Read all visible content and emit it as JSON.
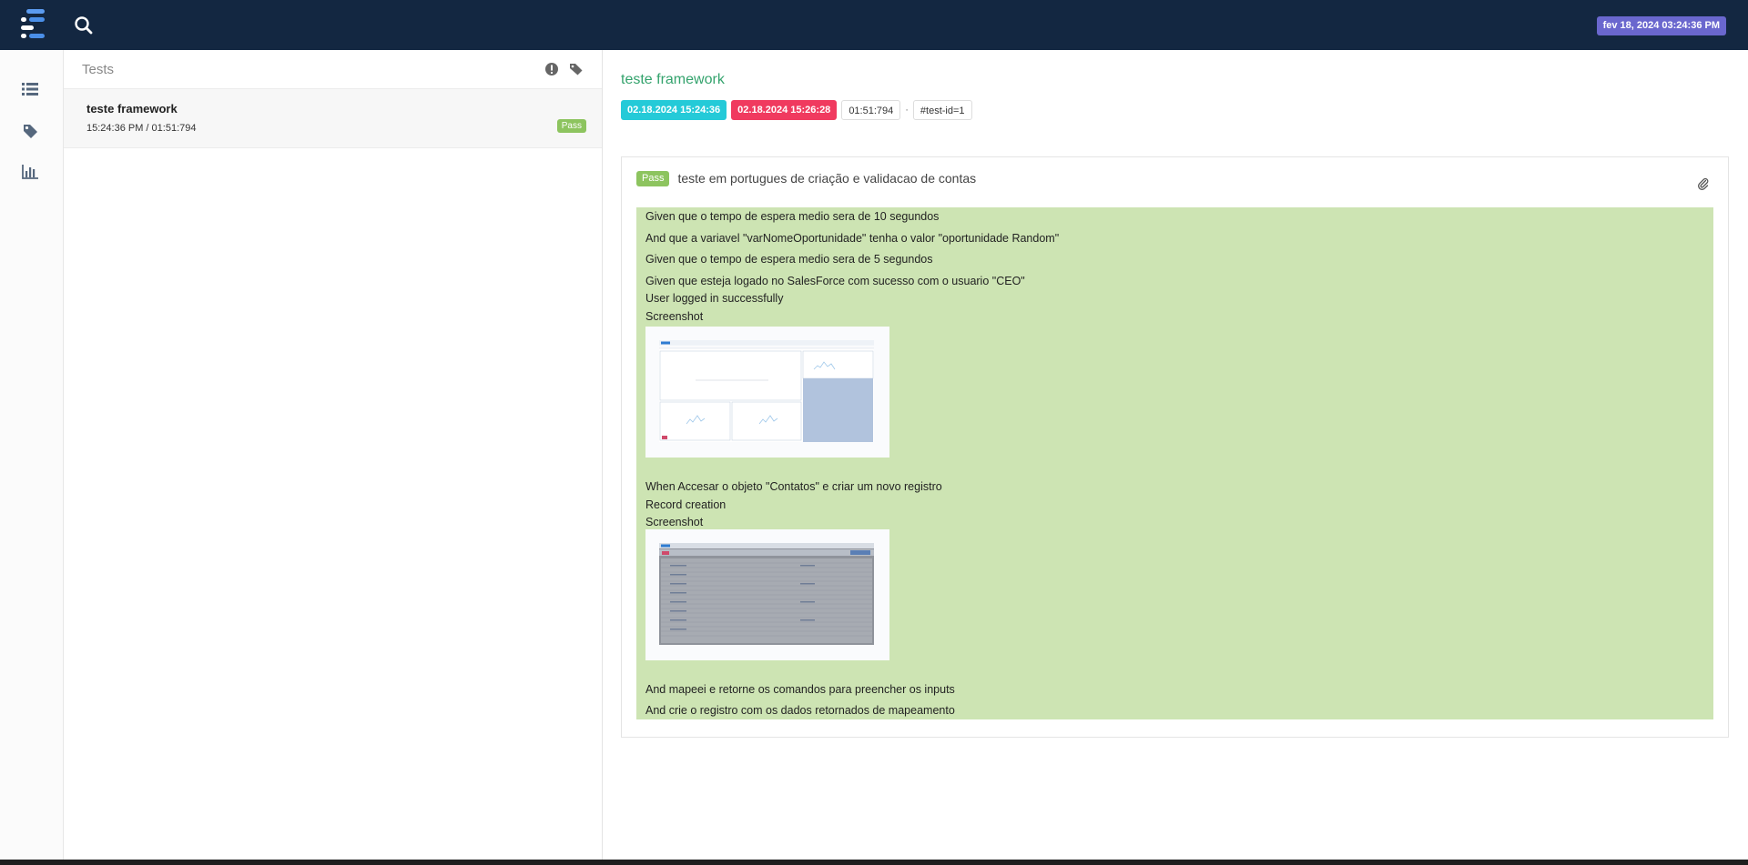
{
  "header": {
    "logo_icon": "extent-logo-icon",
    "search_icon": "search-icon",
    "date_badge": "fev 18, 2024 03:24:36 PM",
    "colors": {
      "bar": "#132741",
      "date_badge": "#6a67ce"
    }
  },
  "nav": {
    "items": [
      {
        "icon": "list-icon"
      },
      {
        "icon": "tag-icon"
      },
      {
        "icon": "bar-chart-icon"
      }
    ]
  },
  "test_list": {
    "title": "Tests",
    "header_icons": [
      "exclamation-circle-icon",
      "tag-icon"
    ],
    "items": [
      {
        "name": "teste framework",
        "time": "15:24:36 PM / 01:51:794",
        "status": "Pass"
      }
    ]
  },
  "detail": {
    "title": "teste framework",
    "start": "02.18.2024 15:24:36",
    "end": "02.18.2024 15:26:28",
    "duration": "01:51:794",
    "separator": "·",
    "test_id": "#test-id=1",
    "colors": {
      "title": "#34a36d",
      "start": "#24cad8",
      "end": "#f03a5f",
      "pass": "#8dc45f",
      "steps_bg": "#cde4b3"
    },
    "case": {
      "status": "Pass",
      "title": "teste em portugues de criação e validacao de contas",
      "attachment_icon": "paperclip-icon",
      "steps": [
        "Given que o tempo de espera medio sera de 10 segundos",
        "And que a variavel \"varNomeOportunidade\" tenha o valor \"oportunidade Random\"",
        "Given que o tempo de espera medio sera de 5 segundos",
        "Given que esteja logado no SalesForce com sucesso com o usuario \"CEO\"",
        "User logged in successfully",
        "Screenshot",
        "When Accesar o objeto \"Contatos\" e criar um novo registro",
        "Record creation",
        "Screenshot",
        "And mapeei e retorne os comandos para preencher os inputs",
        "And crie o registro com os dados retornados de mapeamento"
      ]
    }
  }
}
